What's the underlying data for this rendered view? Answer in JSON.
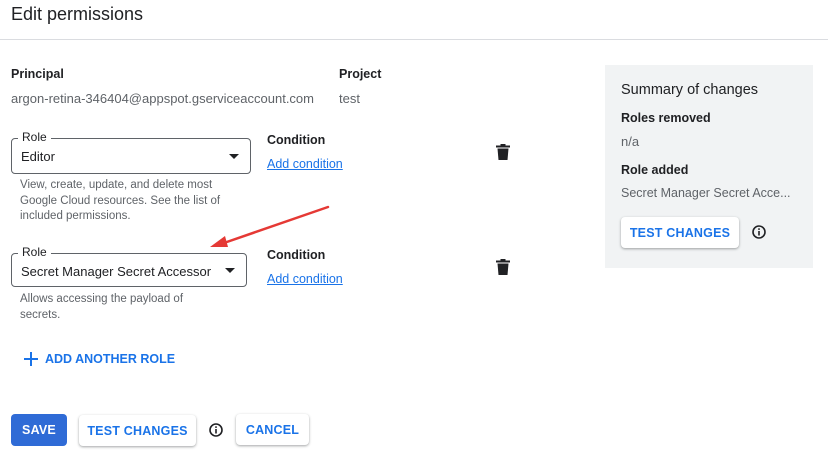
{
  "page": {
    "title": "Edit permissions"
  },
  "principal": {
    "label": "Principal",
    "value": "argon-retina-346404@appspot.gserviceaccount.com"
  },
  "project": {
    "label": "Project",
    "value": "test"
  },
  "roles": [
    {
      "legend": "Role",
      "value": "Editor",
      "help": "View, create, update, and delete most Google Cloud resources. See the list of included permissions.",
      "condition_label": "Condition",
      "add_condition": "Add condition"
    },
    {
      "legend": "Role",
      "value": "Secret Manager Secret Accessor",
      "help": "Allows accessing the payload of secrets.",
      "condition_label": "Condition",
      "add_condition": "Add condition"
    }
  ],
  "add_role": {
    "label": "ADD ANOTHER ROLE"
  },
  "summary": {
    "title": "Summary of changes",
    "removed_label": "Roles removed",
    "removed_value": "n/a",
    "added_label": "Role added",
    "added_value": "Secret Manager Secret Acce...",
    "test_button": "TEST CHANGES"
  },
  "footer": {
    "save": "SAVE",
    "test_changes": "TEST CHANGES",
    "cancel": "CANCEL"
  },
  "icons": {
    "delete": "trash-icon",
    "info": "info-icon",
    "add": "plus-icon",
    "dropdown": "chevron-down-icon",
    "annotation": "red-arrow-icon"
  },
  "colors": {
    "accent": "#1a73e8",
    "primary_button": "#2f6bd6",
    "annotation_arrow": "#e53935",
    "summary_bg": "#f1f3f4"
  }
}
